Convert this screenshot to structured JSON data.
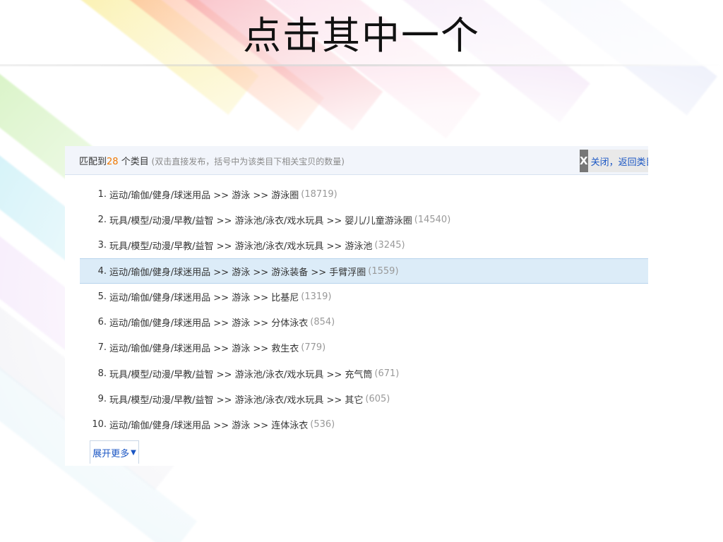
{
  "slide": {
    "title": "点击其中一个"
  },
  "panel": {
    "header": {
      "prefix": "匹配到",
      "count": "28",
      "suffix": " 个类目",
      "hint": " (双击直接发布，括号中为该类目下相关宝贝的数量)"
    },
    "close": {
      "icon": "close-icon",
      "label": "关闭，返回类目"
    },
    "items": [
      {
        "num": "1.",
        "path": "运动/瑜伽/健身/球迷用品 >> 游泳 >> 游泳圈",
        "count": "(18719)"
      },
      {
        "num": "2.",
        "path": "玩具/模型/动漫/早教/益智 >> 游泳池/泳衣/戏水玩具 >> 婴儿/儿童游泳圈",
        "count": "(14540)"
      },
      {
        "num": "3.",
        "path": "玩具/模型/动漫/早教/益智 >> 游泳池/泳衣/戏水玩具 >> 游泳池",
        "count": "(3245)"
      },
      {
        "num": "4.",
        "path": "运动/瑜伽/健身/球迷用品 >> 游泳 >> 游泳装备 >> 手臂浮圈",
        "count": "(1559)"
      },
      {
        "num": "5.",
        "path": "运动/瑜伽/健身/球迷用品 >> 游泳 >> 比基尼",
        "count": "(1319)"
      },
      {
        "num": "6.",
        "path": "运动/瑜伽/健身/球迷用品 >> 游泳 >> 分体泳衣",
        "count": "(854)"
      },
      {
        "num": "7.",
        "path": "运动/瑜伽/健身/球迷用品 >> 游泳 >> 救生衣",
        "count": "(779)"
      },
      {
        "num": "8.",
        "path": "玩具/模型/动漫/早教/益智 >> 游泳池/泳衣/戏水玩具 >> 充气筒",
        "count": "(671)"
      },
      {
        "num": "9.",
        "path": "玩具/模型/动漫/早教/益智 >> 游泳池/泳衣/戏水玩具 >> 其它",
        "count": "(605)"
      },
      {
        "num": "10.",
        "path": "运动/瑜伽/健身/球迷用品 >> 游泳 >> 连体泳衣",
        "count": "(536)"
      }
    ],
    "highlighted_index": 3,
    "more": {
      "label": "展开更多",
      "icon": "triangle-down-icon"
    }
  },
  "colors": {
    "count_accent": "#f07800",
    "link": "#1a56c4",
    "highlight_row": "#dcecf8"
  }
}
